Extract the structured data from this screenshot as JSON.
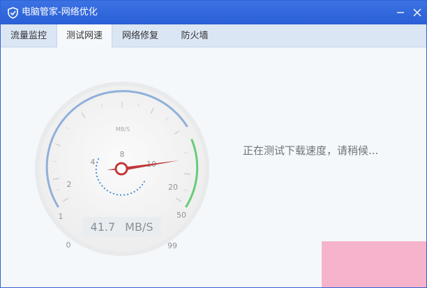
{
  "window": {
    "title": "电脑管家-网络优化",
    "icons": {
      "app": "shield-logo-icon",
      "minimize": "minimize-icon",
      "close": "close-icon"
    }
  },
  "tabs": [
    {
      "label": "流量监控",
      "active": false
    },
    {
      "label": "测试网速",
      "active": true
    },
    {
      "label": "网络修复",
      "active": false
    },
    {
      "label": "防火墙",
      "active": false
    }
  ],
  "gauge": {
    "unit_label": "MB/S",
    "scale_labels": [
      "0",
      "1",
      "2",
      "4",
      "8",
      "10",
      "20",
      "50",
      "99"
    ],
    "current_value": "41.7",
    "current_unit": "MB/S",
    "colors": {
      "arc_blue": "#8fb0db",
      "arc_green": "#66cc77",
      "needle": "#c0383b",
      "dots": "#4a90d9"
    }
  },
  "status": {
    "message": "正在测试下载速度，请稍候..."
  }
}
